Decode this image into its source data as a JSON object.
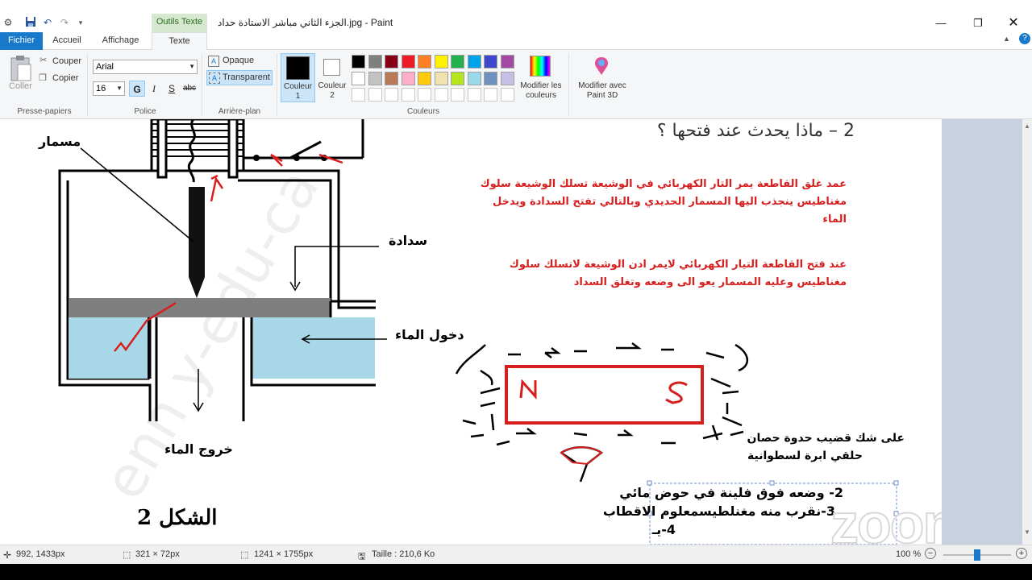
{
  "title_bar": {
    "context_tab": "Outils Texte",
    "title": "الجزء الثاني مباشر الاستادة حداد.jpg - Paint",
    "quick_access_icons": [
      "save-icon",
      "undo-icon",
      "redo-icon",
      "customize-icon"
    ]
  },
  "tabs": [
    "Fichier",
    "Accueil",
    "Affichage",
    "Texte"
  ],
  "ribbon": {
    "clipboard": {
      "paste": "Coller",
      "cut": "Couper",
      "copy": "Copier",
      "label": "Presse-papiers"
    },
    "font": {
      "family": "Arial",
      "size": "16",
      "bold": "G",
      "italic": "I",
      "underline": "S",
      "strike": "abc",
      "label": "Police"
    },
    "background": {
      "opaque": "Opaque",
      "transparent": "Transparent",
      "label": "Arrière-plan"
    },
    "colors": {
      "color1": "Couleur 1",
      "color2": "Couleur 2",
      "edit": "Modifier les couleurs",
      "paint3d": "Modifier avec Paint 3D",
      "label": "Couleurs",
      "palette_row1": [
        "#000000",
        "#7f7f7f",
        "#880015",
        "#ed1c24",
        "#ff7f27",
        "#fff200",
        "#22b14c",
        "#00a2e8",
        "#3f48cc",
        "#a349a4"
      ],
      "palette_row2": [
        "#ffffff",
        "#c3c3c3",
        "#b97a57",
        "#ffaec9",
        "#ffc90e",
        "#efe4b0",
        "#b5e61d",
        "#99d9ea",
        "#7092be",
        "#c8bfe7"
      ]
    }
  },
  "canvas": {
    "diagram_labels": {
      "nail": "مسمار",
      "plug": "سدادة",
      "water_in": "دخول الماء",
      "water_out": "خروج الماء",
      "figure": "الشكل 2"
    },
    "question": "2 – ماذا يحدث عند فتحها ؟",
    "answer1": "عمد غلق القاطعة يمر التار الكهربائي في الوشيعة تسلك الوشيعة سلوك مغناطيس ينجذب اليها المسمار الحديدي  وبالتالي تفتح السدادة  ويدخل الماء",
    "answer2": "عند فتح القاطعة التيار الكهربائي لايمر ادن الوشيعة لاتسلك سلوك مغناطيس وعليه المسمار يعو الى وضعه وتغلق السداد",
    "magnet_n": "N",
    "magnet_s": "S",
    "shapes_note_line1": "على شك قضيب حدوة حصان",
    "shapes_note_line2": "حلقي ابرة لسطوانية",
    "textbox_line1": "2- وضعه فوق فلينة في حوض مائي",
    "textbox_line2": "3-نقرب منه مغنلطيسمعلوم الاقطاب",
    "textbox_line3": "4-يـ",
    "watermark": "zoom"
  },
  "status": {
    "cursor": "992, 1433px",
    "selection": "321 × 72px",
    "image_size": "1241 × 1755px",
    "file_size": "Taille : 210,6 Ko",
    "zoom": "100 %",
    "zoom_fraction": 0.5
  }
}
